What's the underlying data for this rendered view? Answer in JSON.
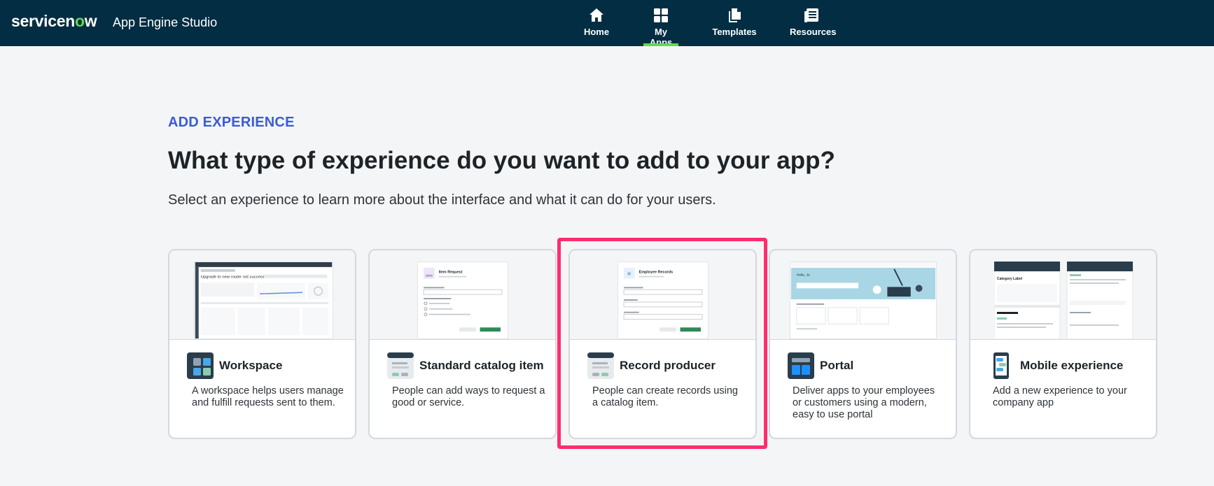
{
  "header": {
    "logo_text_a": "servicen",
    "logo_text_b": "o",
    "logo_text_c": "w",
    "app_title": "App Engine Studio",
    "nav": [
      {
        "label": "Home",
        "icon": "home-icon",
        "active": false
      },
      {
        "label": "My Apps",
        "icon": "grid-icon",
        "active": true
      },
      {
        "label": "Templates",
        "icon": "templates-icon",
        "active": false
      },
      {
        "label": "Resources",
        "icon": "resources-icon",
        "active": false
      }
    ]
  },
  "main": {
    "eyebrow": "ADD EXPERIENCE",
    "title": "What type of experience do you want to add to your app?",
    "subtitle": "Select an experience to learn more about the interface and what it can do for your users."
  },
  "cards": [
    {
      "title": "Workspace",
      "description": "A workspace helps users manage and fulfill requests sent to them.",
      "icon": "workspace-icon"
    },
    {
      "title": "Standard catalog item",
      "description": "People can add ways to request a good or service.",
      "icon": "catalog-item-icon"
    },
    {
      "title": "Record producer",
      "description": "People can create records using a catalog item.",
      "icon": "record-producer-icon",
      "highlighted": true
    },
    {
      "title": "Portal",
      "description": "Deliver apps to your employees or customers using a modern, easy to use portal",
      "icon": "portal-icon"
    },
    {
      "title": "Mobile experience",
      "description": "Add a new experience to your company app",
      "icon": "mobile-icon"
    }
  ],
  "previews": {
    "workspace_heading": "Upgrade to new router not successful",
    "catalog_heading": "Item Request",
    "record_heading": "Employee Records",
    "portal_heading": "Hello, Jo",
    "mobile_heading": "Category Label"
  },
  "colors": {
    "topbar": "#032d42",
    "accent_green": "#62d84e",
    "eyebrow_blue": "#3a5bd9",
    "highlight": "#ff2d6d"
  }
}
